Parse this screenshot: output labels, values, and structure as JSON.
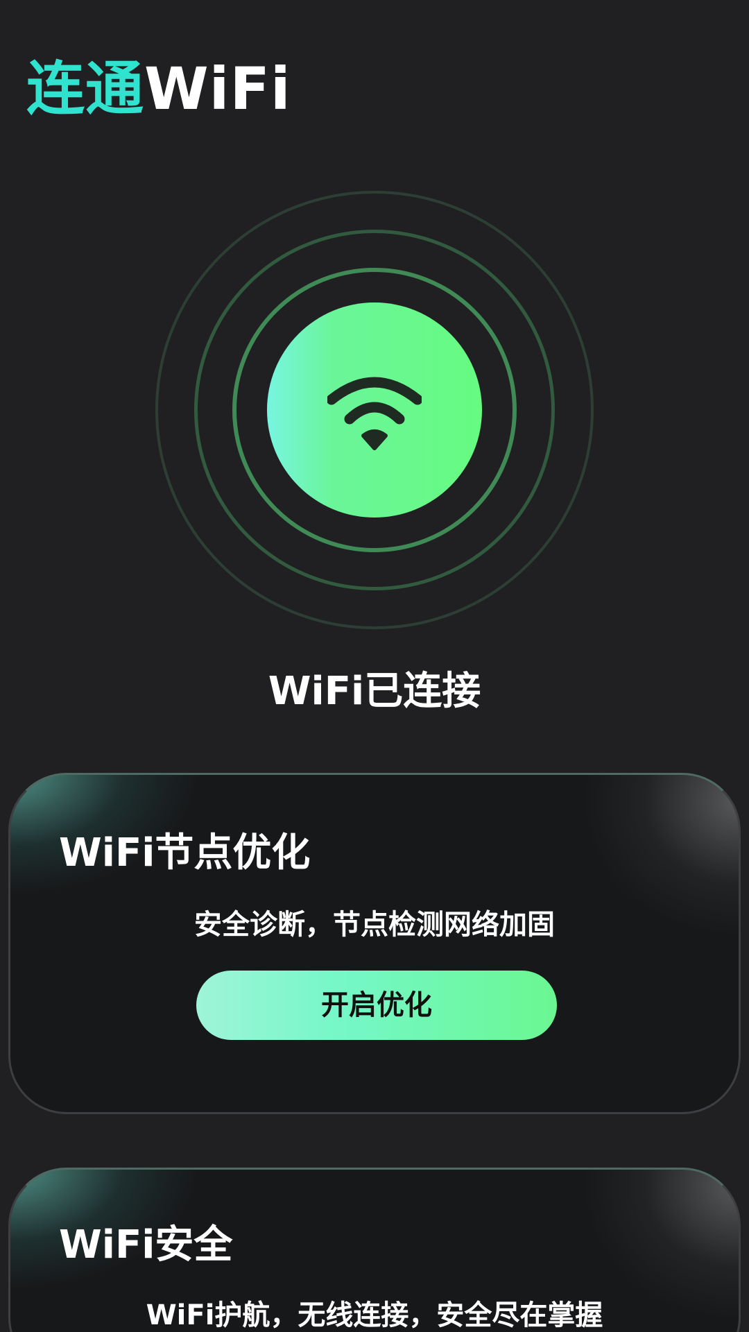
{
  "header": {
    "title_accent": "连通",
    "title_rest": "WiFi"
  },
  "status": {
    "text": "WiFi已连接",
    "icon": "wifi-icon"
  },
  "cards": [
    {
      "title": "WiFi节点优化",
      "description": "安全诊断，节点检测网络加固",
      "button_label": "开启优化"
    },
    {
      "title": "WiFi安全",
      "description": "WiFi护航，无线连接，安全尽在掌握"
    }
  ],
  "colors": {
    "background": "#202023",
    "accent": "#2fe3cf",
    "signal_green": "#66fb80",
    "card_background": "#17181a"
  }
}
